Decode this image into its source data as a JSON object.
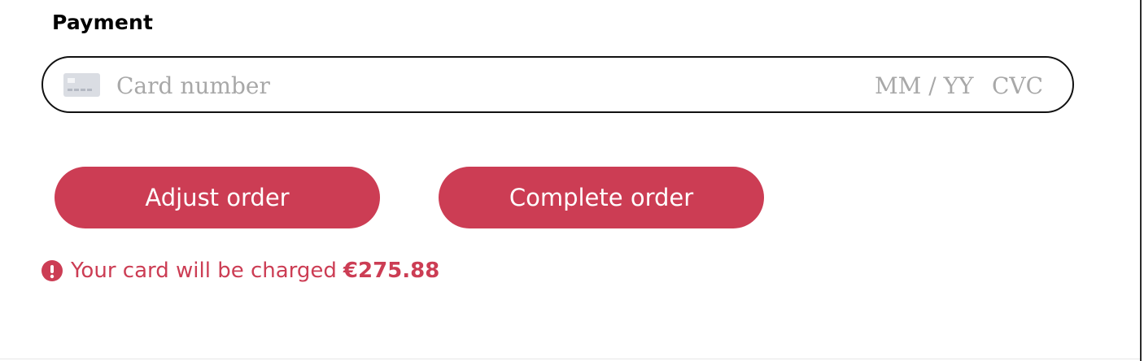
{
  "payment": {
    "title": "Payment",
    "card_icon": "credit-card-icon",
    "card_number_placeholder": "Card number",
    "card_number_value": "",
    "expiry_placeholder": "MM / YY",
    "expiry_value": "",
    "cvc_placeholder": "CVC",
    "cvc_value": ""
  },
  "actions": {
    "adjust_label": "Adjust order",
    "complete_label": "Complete order"
  },
  "notice": {
    "icon": "exclamation-circle-icon",
    "text": "Your card will be charged",
    "amount": "€275.88"
  },
  "colors": {
    "accent": "#cc3d54",
    "placeholder": "#a8a8a8",
    "field_border": "#111111"
  }
}
